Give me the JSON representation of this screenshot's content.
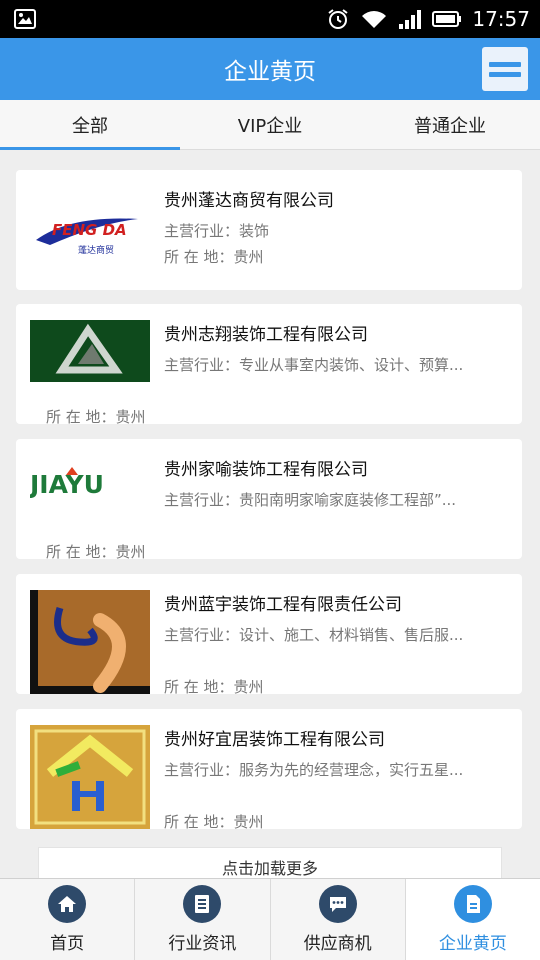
{
  "status": {
    "time": "17:57"
  },
  "header": {
    "title": "企业黄页"
  },
  "tabs": [
    {
      "label": "全部",
      "active": true
    },
    {
      "label": "VIP企业",
      "active": false
    },
    {
      "label": "普通企业",
      "active": false
    }
  ],
  "companies": [
    {
      "name": "贵州蓬达商贸有限公司",
      "industry": "主营行业：装饰",
      "location": "所 在 地：贵州",
      "logo_text": "FENG DA",
      "logo_subtext": "蓬达商贸"
    },
    {
      "name": "贵州志翔装饰工程有限公司",
      "industry": "主营行业：专业从事室内装饰、设计、预算...",
      "location": "所 在 地：贵州"
    },
    {
      "name": "贵州家喻装饰工程有限公司",
      "industry": "主营行业：贵阳南明家喻家庭装修工程部”...",
      "location": "所 在 地：贵州",
      "logo_text": "JIAYU"
    },
    {
      "name": "贵州蓝宇装饰工程有限责任公司",
      "industry": "主营行业：设计、施工、材料销售、售后服...",
      "location": "所 在 地：贵州"
    },
    {
      "name": "贵州好宜居装饰工程有限公司",
      "industry": "主营行业：服务为先的经营理念，实行五星...",
      "location": "所 在 地：贵州"
    }
  ],
  "load_more": "点击加载更多",
  "nav": [
    {
      "label": "首页",
      "icon": "home-icon",
      "active": false
    },
    {
      "label": "行业资讯",
      "icon": "document-icon",
      "active": false
    },
    {
      "label": "供应商机",
      "icon": "chat-icon",
      "active": false
    },
    {
      "label": "企业黄页",
      "icon": "file-icon",
      "active": true
    }
  ],
  "colors": {
    "accent": "#3a96e8",
    "nav_dark": "#2e4a6a"
  }
}
